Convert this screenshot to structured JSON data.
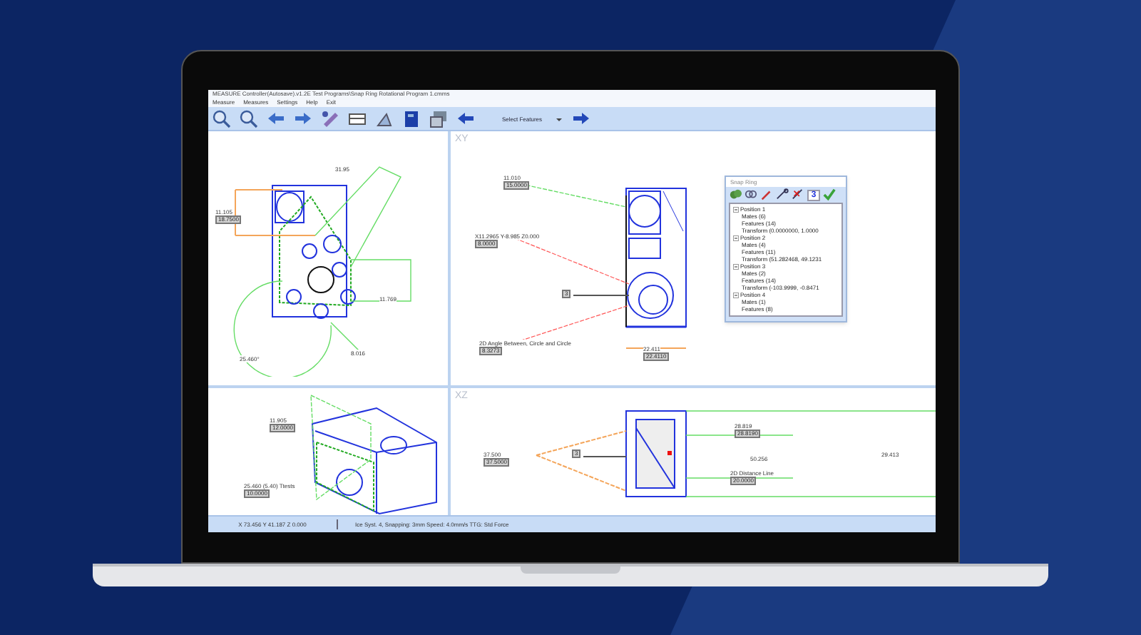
{
  "window": {
    "title": "MEASURE Controller(Autosave).v1.2E Test Programs\\Snap Ring Rotational Program 1.cmms"
  },
  "menu": [
    "Measure",
    "Measures",
    "Settings",
    "Help",
    "Exit"
  ],
  "toolbar": {
    "feature_select": "Select Features"
  },
  "views": [
    {
      "annotations": [
        {
          "text": "31.95"
        },
        {
          "text": "11.105",
          "value": "18.7500"
        },
        {
          "text": "11.769"
        },
        {
          "text": "25.460°"
        },
        {
          "text": "8.016"
        }
      ]
    },
    {
      "label": "XY",
      "annotations": [
        {
          "text": "11.010",
          "value": "15.0000"
        },
        {
          "text": "X11.2965 Y-8.985 Z0.000",
          "value": "8.0000"
        },
        {
          "value": "3"
        },
        {
          "text": "2D Angle Between, Circle and Circle",
          "value": "8.3273"
        },
        {
          "text": "22.411",
          "value": "22.4110"
        }
      ]
    },
    {
      "annotations": [
        {
          "text": "11.905",
          "value": "12.0000"
        },
        {
          "text": "25.460 (5.40) Ttests",
          "value": "10.0000"
        }
      ]
    },
    {
      "label": "XZ",
      "annotations": [
        {
          "text": "37.500",
          "value": "37.5000"
        },
        {
          "value": "3"
        },
        {
          "text": "28.819",
          "value": "28.8190"
        },
        {
          "text": "50.256"
        },
        {
          "text": "29.413"
        },
        {
          "text": "2D Distance Line",
          "value": "20.0000"
        }
      ]
    }
  ],
  "panel": {
    "title": "Snap Ring",
    "count": "3",
    "tree": [
      {
        "label": "Position 1",
        "expanded": true,
        "children": [
          {
            "label": "Mates (6)"
          },
          {
            "label": "Features (14)"
          },
          {
            "label": "Transform (0.0000000, 1.0000"
          }
        ]
      },
      {
        "label": "Position 2",
        "expanded": true,
        "children": [
          {
            "label": "Mates (4)"
          },
          {
            "label": "Features (11)"
          },
          {
            "label": "Transform (51.282468, 49.1231"
          }
        ]
      },
      {
        "label": "Position 3",
        "expanded": true,
        "children": [
          {
            "label": "Mates (2)"
          },
          {
            "label": "Features (14)"
          },
          {
            "label": "Transform (-103.9999, -0.8471"
          }
        ]
      },
      {
        "label": "Position 4",
        "expanded": true,
        "children": [
          {
            "label": "Mates (1)"
          },
          {
            "label": "Features (8)"
          }
        ]
      }
    ]
  },
  "status_bar": [
    "X 73.456 Y 41.187 Z 0.000",
    "Ice Syst. 4, Snapping: 3mm Speed: 4.0mm/s TTG: Std Force"
  ]
}
